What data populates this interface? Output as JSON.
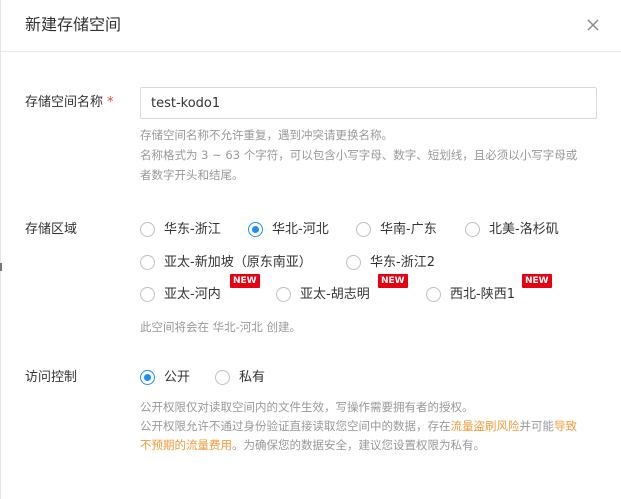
{
  "dialog": {
    "title": "新建存储空间",
    "close_icon": "close-icon"
  },
  "bucket_name": {
    "label": "存储空间名称",
    "required_mark": "*",
    "value": "test-kodo1",
    "help_line1": "存储空间名称不允许重复，遇到冲突请更换名称。",
    "help_line2": "名称格式为 3 ~ 63 个字符，可以包含小写字母、数字、短划线，且必须以小写字母或",
    "help_line3": "者数字开头和结尾。"
  },
  "region": {
    "label": "存储区域",
    "options": [
      {
        "label": "华东-浙江",
        "checked": false,
        "badge": ""
      },
      {
        "label": "华北-河北",
        "checked": true,
        "badge": ""
      },
      {
        "label": "华南-广东",
        "checked": false,
        "badge": ""
      },
      {
        "label": "北美-洛杉矶",
        "checked": false,
        "badge": ""
      },
      {
        "label": "亚太-新加坡（原东南亚）",
        "checked": false,
        "badge": ""
      },
      {
        "label": "华东-浙江2",
        "checked": false,
        "badge": ""
      },
      {
        "label": "亚太-河内",
        "checked": false,
        "badge": "NEW"
      },
      {
        "label": "亚太-胡志明",
        "checked": false,
        "badge": "NEW"
      },
      {
        "label": "西北-陕西1",
        "checked": false,
        "badge": "NEW"
      }
    ],
    "note": "此空间将会在 华北-河北 创建。"
  },
  "access": {
    "label": "访问控制",
    "options": [
      {
        "label": "公开",
        "checked": true
      },
      {
        "label": "私有",
        "checked": false
      }
    ],
    "help_line1": "公开权限仅对读取空间内的文件生效，写操作需要拥有者的授权。",
    "help_line2_part1": "公开权限允许不通过身份验证直接读取您空间中的数据，存在",
    "help_line2_link1": "流量盗刷风险",
    "help_line2_part2": "并可能",
    "help_line2_link2": "导致",
    "help_line3_link": "不预期的流量费用",
    "help_line3_part": "。为确保您的数据安全，建议您设置权限为私有。"
  },
  "colors": {
    "accent": "#1c8ef0",
    "warning": "#f29b39",
    "required": "#f04134",
    "badge": "#e60012"
  }
}
